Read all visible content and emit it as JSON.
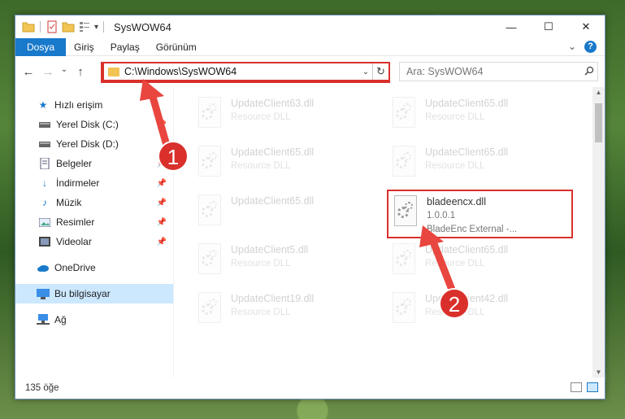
{
  "window": {
    "title": "SysWOW64",
    "minimize": "—",
    "maximize": "☐",
    "close": "✕"
  },
  "ribbon": {
    "tabs": [
      "Dosya",
      "Giriş",
      "Paylaş",
      "Görünüm"
    ],
    "expand": "⌄",
    "help": "?"
  },
  "nav_bar": {
    "back": "←",
    "forward": "→",
    "recent": "⌄",
    "up": "↑"
  },
  "address": {
    "path": "C:\\Windows\\SysWOW64",
    "dropdown": "⌄",
    "refresh": "↻"
  },
  "search": {
    "placeholder": "Ara: SysWOW64",
    "icon": "search-icon"
  },
  "sidebar": {
    "quick_access": "Hızlı erişim",
    "items": [
      {
        "label": "Yerel Disk (C:)",
        "icon": "drive-icon",
        "pinned": true
      },
      {
        "label": "Yerel Disk (D:)",
        "icon": "drive-icon",
        "pinned": false
      },
      {
        "label": "Belgeler",
        "icon": "document-icon",
        "pinned": true
      },
      {
        "label": "İndirmeler",
        "icon": "download-icon",
        "pinned": true
      },
      {
        "label": "Müzik",
        "icon": "music-icon",
        "pinned": true
      },
      {
        "label": "Resimler",
        "icon": "pictures-icon",
        "pinned": true
      },
      {
        "label": "Videolar",
        "icon": "video-icon",
        "pinned": true
      }
    ],
    "onedrive": "OneDrive",
    "this_pc": "Bu bilgisayar",
    "network": "Ağ"
  },
  "files": [
    {
      "name": "UpdateClient63.dll",
      "desc": "Resource DLL",
      "faded": true
    },
    {
      "name": "UpdateClient65.dll",
      "desc": "Resource DLL",
      "faded": true
    },
    {
      "name": "UpdateClient65.dll",
      "desc": "Resource DLL",
      "faded": true
    },
    {
      "name": "UpdateClient65.dll",
      "desc": "Resource DLL",
      "faded": true
    },
    {
      "name": "UpdateClient65.dll",
      "desc": "",
      "faded": true
    },
    {
      "name": "bladeencx.dll",
      "version": "1.0.0.1",
      "desc": "BladeEnc External -...",
      "faded": false
    },
    {
      "name": "UpdateClient5.dll",
      "desc": "Resource DLL",
      "faded": true
    },
    {
      "name": "UpdateClient65.dll",
      "desc": "Resource DLL",
      "faded": true
    },
    {
      "name": "UpdateClient19.dll",
      "desc": "Resource DLL",
      "faded": true
    },
    {
      "name": "UpdateClient42.dll",
      "desc": "Resource DLL",
      "faded": true
    }
  ],
  "status": {
    "count": "135 öğe"
  },
  "callouts": [
    "1",
    "2"
  ],
  "colors": {
    "accent": "#1979ca",
    "highlight": "#d9302c",
    "selection": "#cce8ff"
  }
}
